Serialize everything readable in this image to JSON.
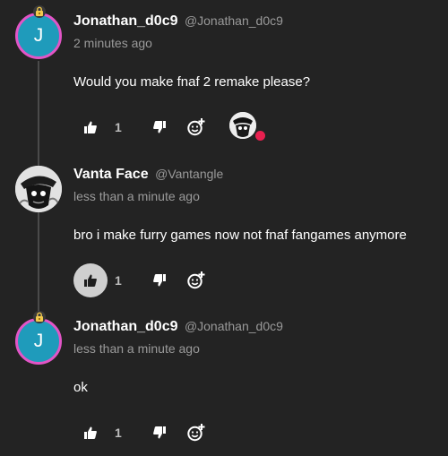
{
  "comments": [
    {
      "avatar_letter": "J",
      "name": "Jonathan_d0c9",
      "handle": "@Jonathan_d0c9",
      "time": "2 minutes ago",
      "text": "Would you make fnaf 2 remake please?",
      "likes": "1",
      "like_active": false,
      "has_reaction": true
    },
    {
      "avatar_letter": "",
      "name": "Vanta Face",
      "handle": "@Vantangle",
      "time": "less than a minute ago",
      "text": "bro i make furry games now not fnaf fangames anymore",
      "likes": "1",
      "like_active": true,
      "has_reaction": false
    },
    {
      "avatar_letter": "J",
      "name": "Jonathan_d0c9",
      "handle": "@Jonathan_d0c9",
      "time": "less than a minute ago",
      "text": "ok",
      "likes": "1",
      "like_active": false,
      "has_reaction": false
    }
  ],
  "colors": {
    "background": "#232323",
    "avatar_fill": "#1f9bbb",
    "avatar_ring": "#e255c6",
    "reaction_dot": "#e8204f"
  }
}
